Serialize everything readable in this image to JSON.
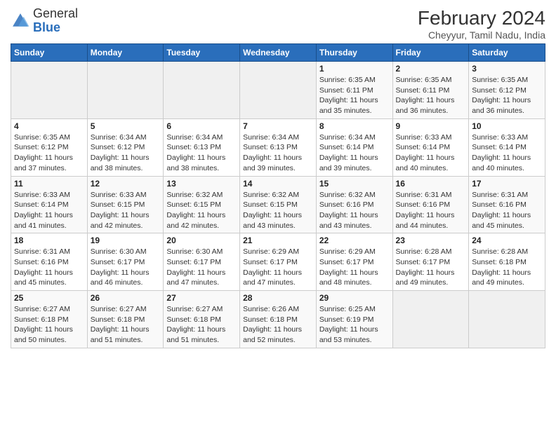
{
  "header": {
    "logo_general": "General",
    "logo_blue": "Blue",
    "title": "February 2024",
    "subtitle": "Cheyyur, Tamil Nadu, India"
  },
  "days_of_week": [
    "Sunday",
    "Monday",
    "Tuesday",
    "Wednesday",
    "Thursday",
    "Friday",
    "Saturday"
  ],
  "weeks": [
    [
      {
        "num": "",
        "info": ""
      },
      {
        "num": "",
        "info": ""
      },
      {
        "num": "",
        "info": ""
      },
      {
        "num": "",
        "info": ""
      },
      {
        "num": "1",
        "info": "Sunrise: 6:35 AM\nSunset: 6:11 PM\nDaylight: 11 hours\nand 35 minutes."
      },
      {
        "num": "2",
        "info": "Sunrise: 6:35 AM\nSunset: 6:11 PM\nDaylight: 11 hours\nand 36 minutes."
      },
      {
        "num": "3",
        "info": "Sunrise: 6:35 AM\nSunset: 6:12 PM\nDaylight: 11 hours\nand 36 minutes."
      }
    ],
    [
      {
        "num": "4",
        "info": "Sunrise: 6:35 AM\nSunset: 6:12 PM\nDaylight: 11 hours\nand 37 minutes."
      },
      {
        "num": "5",
        "info": "Sunrise: 6:34 AM\nSunset: 6:12 PM\nDaylight: 11 hours\nand 38 minutes."
      },
      {
        "num": "6",
        "info": "Sunrise: 6:34 AM\nSunset: 6:13 PM\nDaylight: 11 hours\nand 38 minutes."
      },
      {
        "num": "7",
        "info": "Sunrise: 6:34 AM\nSunset: 6:13 PM\nDaylight: 11 hours\nand 39 minutes."
      },
      {
        "num": "8",
        "info": "Sunrise: 6:34 AM\nSunset: 6:14 PM\nDaylight: 11 hours\nand 39 minutes."
      },
      {
        "num": "9",
        "info": "Sunrise: 6:33 AM\nSunset: 6:14 PM\nDaylight: 11 hours\nand 40 minutes."
      },
      {
        "num": "10",
        "info": "Sunrise: 6:33 AM\nSunset: 6:14 PM\nDaylight: 11 hours\nand 40 minutes."
      }
    ],
    [
      {
        "num": "11",
        "info": "Sunrise: 6:33 AM\nSunset: 6:14 PM\nDaylight: 11 hours\nand 41 minutes."
      },
      {
        "num": "12",
        "info": "Sunrise: 6:33 AM\nSunset: 6:15 PM\nDaylight: 11 hours\nand 42 minutes."
      },
      {
        "num": "13",
        "info": "Sunrise: 6:32 AM\nSunset: 6:15 PM\nDaylight: 11 hours\nand 42 minutes."
      },
      {
        "num": "14",
        "info": "Sunrise: 6:32 AM\nSunset: 6:15 PM\nDaylight: 11 hours\nand 43 minutes."
      },
      {
        "num": "15",
        "info": "Sunrise: 6:32 AM\nSunset: 6:16 PM\nDaylight: 11 hours\nand 43 minutes."
      },
      {
        "num": "16",
        "info": "Sunrise: 6:31 AM\nSunset: 6:16 PM\nDaylight: 11 hours\nand 44 minutes."
      },
      {
        "num": "17",
        "info": "Sunrise: 6:31 AM\nSunset: 6:16 PM\nDaylight: 11 hours\nand 45 minutes."
      }
    ],
    [
      {
        "num": "18",
        "info": "Sunrise: 6:31 AM\nSunset: 6:16 PM\nDaylight: 11 hours\nand 45 minutes."
      },
      {
        "num": "19",
        "info": "Sunrise: 6:30 AM\nSunset: 6:17 PM\nDaylight: 11 hours\nand 46 minutes."
      },
      {
        "num": "20",
        "info": "Sunrise: 6:30 AM\nSunset: 6:17 PM\nDaylight: 11 hours\nand 47 minutes."
      },
      {
        "num": "21",
        "info": "Sunrise: 6:29 AM\nSunset: 6:17 PM\nDaylight: 11 hours\nand 47 minutes."
      },
      {
        "num": "22",
        "info": "Sunrise: 6:29 AM\nSunset: 6:17 PM\nDaylight: 11 hours\nand 48 minutes."
      },
      {
        "num": "23",
        "info": "Sunrise: 6:28 AM\nSunset: 6:17 PM\nDaylight: 11 hours\nand 49 minutes."
      },
      {
        "num": "24",
        "info": "Sunrise: 6:28 AM\nSunset: 6:18 PM\nDaylight: 11 hours\nand 49 minutes."
      }
    ],
    [
      {
        "num": "25",
        "info": "Sunrise: 6:27 AM\nSunset: 6:18 PM\nDaylight: 11 hours\nand 50 minutes."
      },
      {
        "num": "26",
        "info": "Sunrise: 6:27 AM\nSunset: 6:18 PM\nDaylight: 11 hours\nand 51 minutes."
      },
      {
        "num": "27",
        "info": "Sunrise: 6:27 AM\nSunset: 6:18 PM\nDaylight: 11 hours\nand 51 minutes."
      },
      {
        "num": "28",
        "info": "Sunrise: 6:26 AM\nSunset: 6:18 PM\nDaylight: 11 hours\nand 52 minutes."
      },
      {
        "num": "29",
        "info": "Sunrise: 6:25 AM\nSunset: 6:19 PM\nDaylight: 11 hours\nand 53 minutes."
      },
      {
        "num": "",
        "info": ""
      },
      {
        "num": "",
        "info": ""
      }
    ]
  ],
  "empty_first_week_cols": 4,
  "empty_last_week_cols": [
    5,
    6
  ]
}
